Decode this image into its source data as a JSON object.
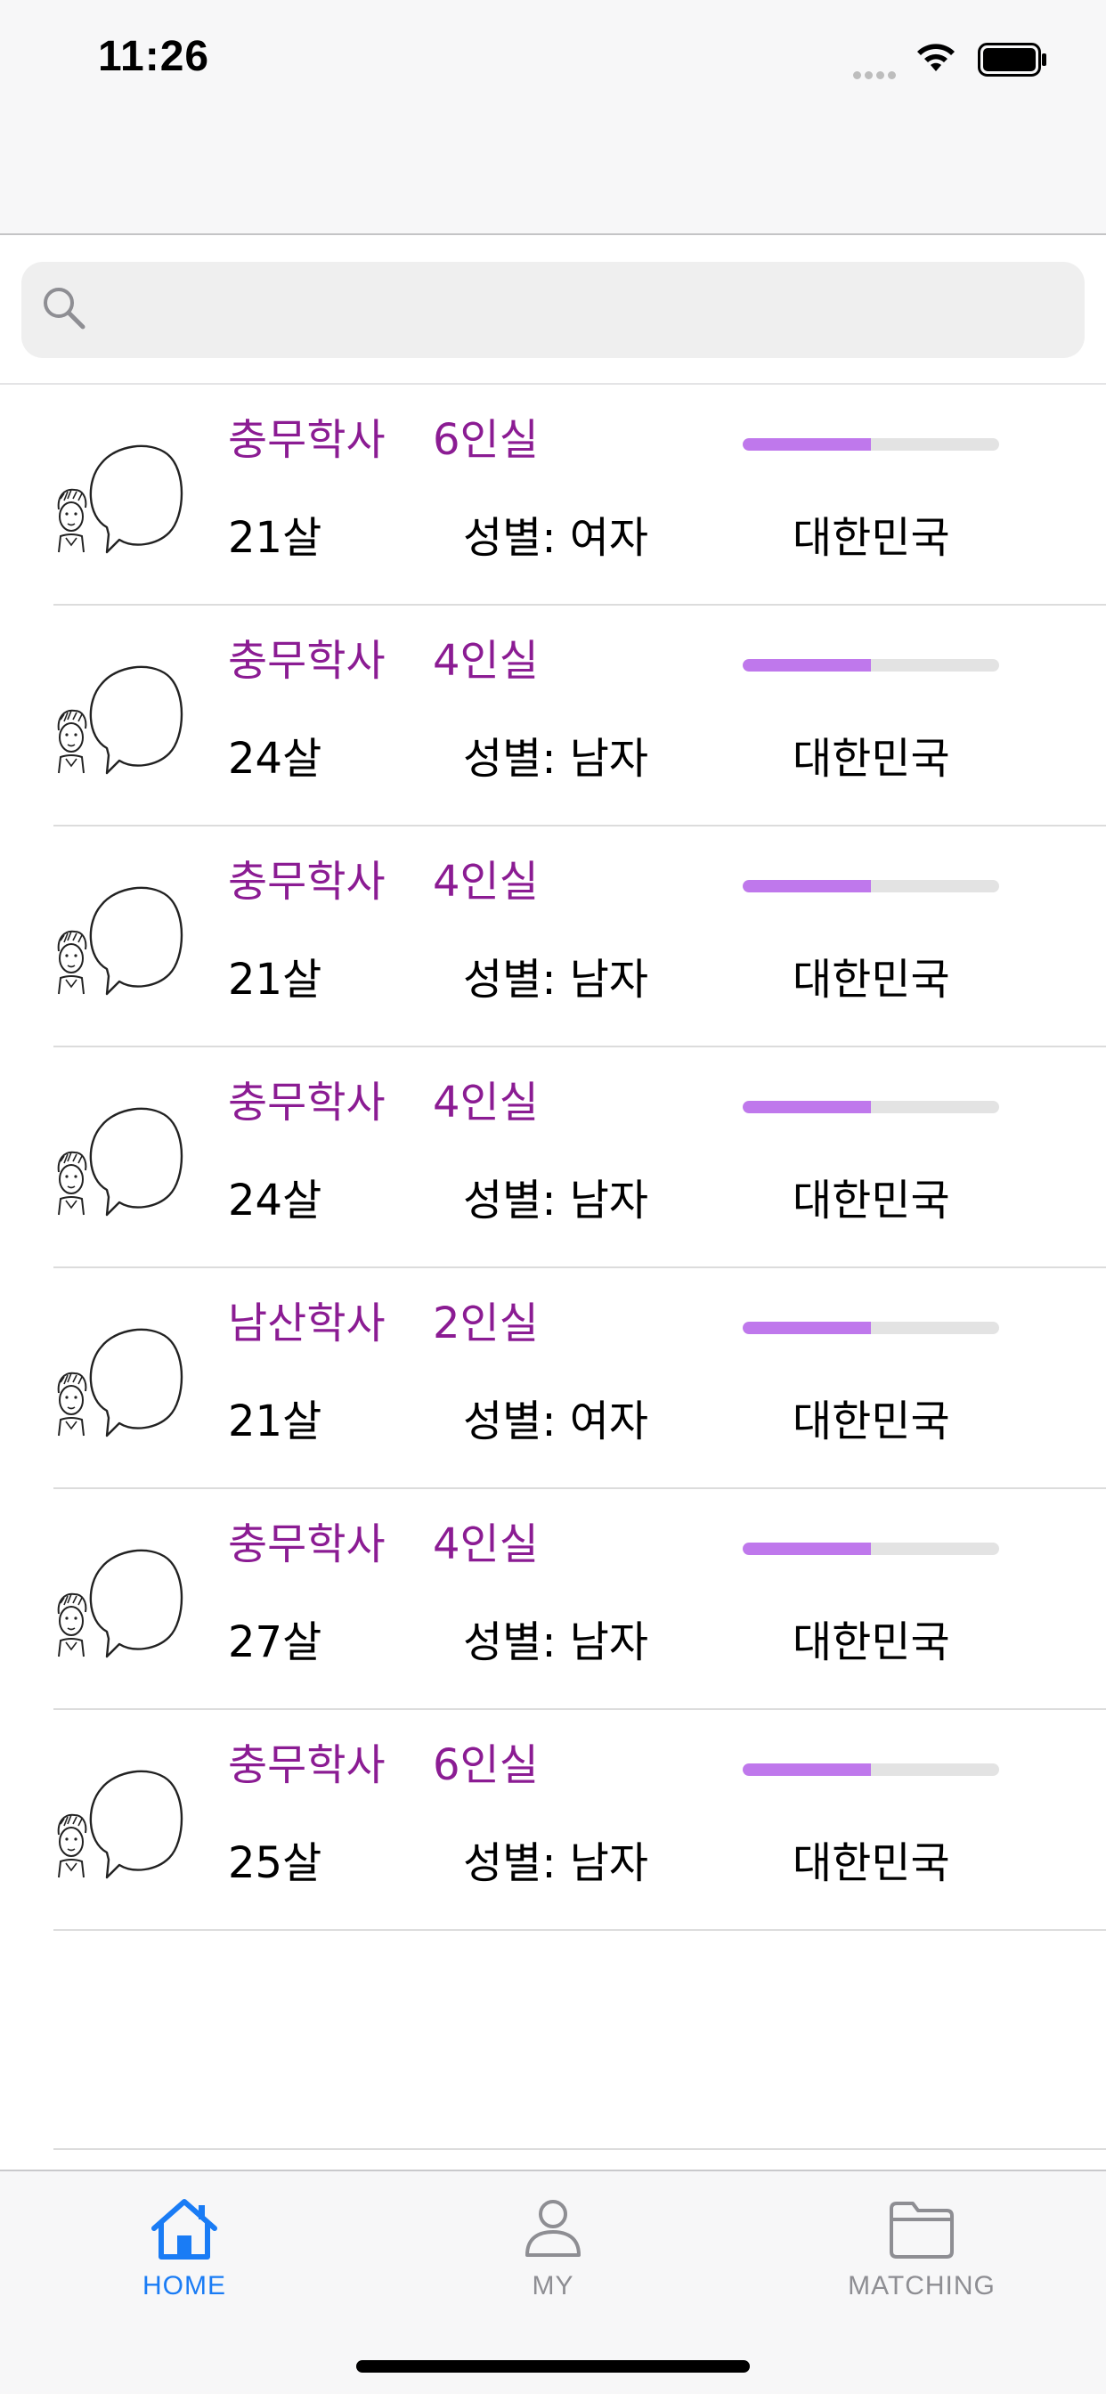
{
  "status_bar": {
    "time": "11:26"
  },
  "search": {
    "placeholder": "",
    "value": ""
  },
  "rows": [
    {
      "dorm": "충무학사",
      "room": "6인실",
      "age": "21살",
      "gender_label": "성별:",
      "gender": "여자",
      "country": "대한민국",
      "progress": 0.5
    },
    {
      "dorm": "충무학사",
      "room": "4인실",
      "age": "24살",
      "gender_label": "성별:",
      "gender": "남자",
      "country": "대한민국",
      "progress": 0.5
    },
    {
      "dorm": "충무학사",
      "room": "4인실",
      "age": "21살",
      "gender_label": "성별:",
      "gender": "남자",
      "country": "대한민국",
      "progress": 0.5
    },
    {
      "dorm": "충무학사",
      "room": "4인실",
      "age": "24살",
      "gender_label": "성별:",
      "gender": "남자",
      "country": "대한민국",
      "progress": 0.5
    },
    {
      "dorm": "남산학사",
      "room": "2인실",
      "age": "21살",
      "gender_label": "성별:",
      "gender": "여자",
      "country": "대한민국",
      "progress": 0.5
    },
    {
      "dorm": "충무학사",
      "room": "4인실",
      "age": "27살",
      "gender_label": "성별:",
      "gender": "남자",
      "country": "대한민국",
      "progress": 0.5
    },
    {
      "dorm": "충무학사",
      "room": "6인실",
      "age": "25살",
      "gender_label": "성별:",
      "gender": "남자",
      "country": "대한민국",
      "progress": 0.5
    }
  ],
  "tabs": [
    {
      "label": "HOME",
      "icon": "home-icon",
      "active": true
    },
    {
      "label": "MY",
      "icon": "person-icon",
      "active": false
    },
    {
      "label": "MATCHING",
      "icon": "folder-icon",
      "active": false
    }
  ],
  "colors": {
    "accent": "#1a7cf5",
    "dorm_text": "#8b1c93",
    "progress_fill": "#bf78ec",
    "progress_track": "#e3e3e3",
    "inactive_tab": "#8e8e93"
  }
}
